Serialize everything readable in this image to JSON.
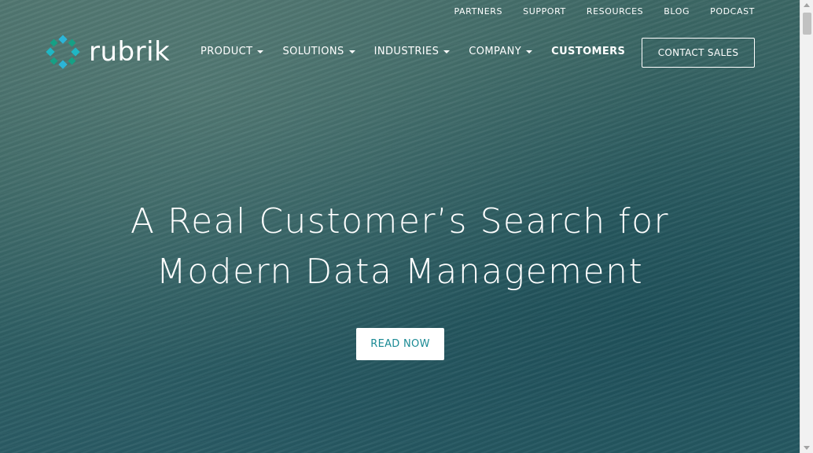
{
  "top_links": [
    "PARTNERS",
    "SUPPORT",
    "RESOURCES",
    "BLOG",
    "PODCAST"
  ],
  "logo": {
    "text": "rubrik",
    "icon": "rubrik-logo-icon",
    "colors": [
      "#1fb7c4",
      "#16a085",
      "#2bb5d8"
    ]
  },
  "nav": {
    "items": [
      {
        "label": "PRODUCT",
        "dropdown": true
      },
      {
        "label": "SOLUTIONS",
        "dropdown": true
      },
      {
        "label": "INDUSTRIES",
        "dropdown": true
      },
      {
        "label": "COMPANY",
        "dropdown": true
      },
      {
        "label": "CUSTOMERS",
        "dropdown": false
      }
    ],
    "contact_label": "CONTACT SALES"
  },
  "hero": {
    "line1": "A Real Customer’s Search for",
    "line2": "Modern Data Management",
    "cta_label": "READ NOW",
    "cta_color": "#1a8a94"
  }
}
